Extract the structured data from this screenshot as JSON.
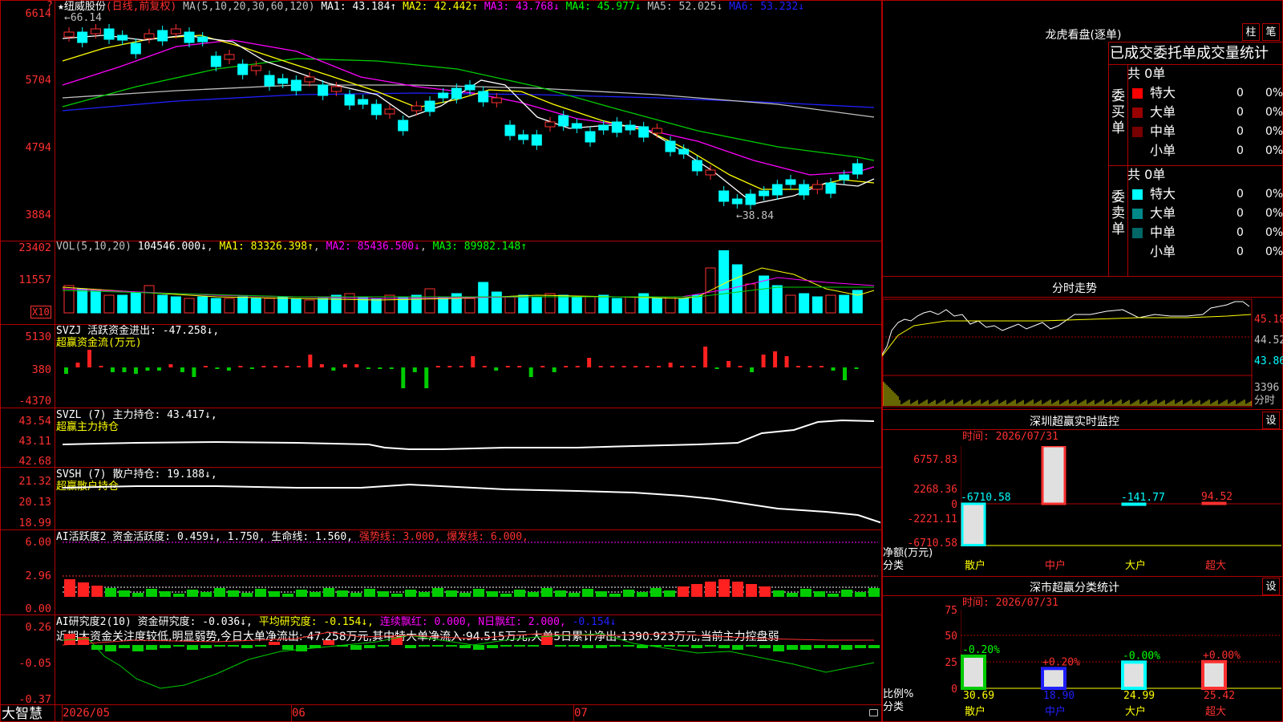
{
  "header": {
    "star": "★",
    "stock_name": "纽威股份",
    "mode": "(日线,前复权)",
    "ma_params": "MA(5,10,20,30,60,120)",
    "ma1": "MA1: 43.184↑",
    "ma2": "MA2: 42.442↑",
    "ma3": "MA3: 43.768↓",
    "ma4": "MA4: 45.977↓",
    "ma5": "MA5: 52.025↓",
    "ma6": "MA6: 53.232↓",
    "q_mark": "?"
  },
  "price_axis": [
    "6614",
    "5704",
    "4794",
    "3884"
  ],
  "price_annotations": {
    "high": "66.14",
    "low": "38.84"
  },
  "vol": {
    "params": "VOL(5,10,20)",
    "value": "104546.000↓",
    "ma1": "MA1: 83326.398↑",
    "ma2": "MA2: 85436.500↓",
    "ma3": "MA3: 89982.148↑",
    "axis": [
      "23402",
      "11557"
    ],
    "unit": "X10"
  },
  "svzj": {
    "label": "SVZJ  活跃资金进出: -47.258↓,",
    "sub": "超赢资金流(万元)",
    "axis": [
      "5130",
      "380",
      "-4370"
    ]
  },
  "svzl": {
    "label": "SVZL (7) 主力持仓: 43.417↓,",
    "sub": "超赢主力持仓",
    "axis": [
      "43.54",
      "43.11",
      "42.68"
    ]
  },
  "svsh": {
    "label": "SVSH (7) 散户持仓: 19.188↓,",
    "sub": "超赢散户持仓",
    "axis": [
      "21.32",
      "20.13",
      "18.99"
    ]
  },
  "ai1": {
    "label": "AI活跃度2 资金活跃度: 0.459↓, 1.750, 生命线: 1.560,",
    "strong": "强势线: 3.000,",
    "burst": "爆发线: 6.000,",
    "axis": [
      "6.00",
      "2.96",
      "0.00"
    ]
  },
  "ai2": {
    "label": "AI研究度2(10) 资金研究度: -0.036↓,",
    "avg": "平均研究度: -0.154↓,",
    "cont": "连续飘红: 0.000,",
    "nday": "N日飘红: 2.000,",
    "last": "-0.154↓",
    "desc": "近期大资金关注度较低,明显弱势,今日大单净流出:-47.258万元,其中特大单净流入:94.515万元,大单5日累计净出-1390.923万元,当前主力控盘弱",
    "axis": [
      "0.26",
      "-0.05",
      "-0.37"
    ]
  },
  "bottom_bar": {
    "brand": "大智慧",
    "dates": [
      "2026/05",
      "06",
      "07"
    ]
  },
  "right_panel": {
    "lhb_title": "龙虎看盘(逐单)",
    "btn_zhu": "柱",
    "btn_bi": "笔",
    "stats_title": "已成交委托单成交量统计",
    "buy_side": "委买单",
    "sell_side": "委卖单",
    "buy_total": "共 0单",
    "sell_total": "共 0单",
    "rows": [
      {
        "name": "特大",
        "count": "0",
        "pct": "0%"
      },
      {
        "name": "大单",
        "count": "0",
        "pct": "0%"
      },
      {
        "name": "中单",
        "count": "0",
        "pct": "0%"
      },
      {
        "name": "小单",
        "count": "0",
        "pct": "0%"
      }
    ],
    "colors": {
      "buy": [
        "#ff0000",
        "#990000",
        "#770000"
      ],
      "sell": [
        "#00ffff",
        "#008888",
        "#006666"
      ]
    },
    "intraday_title": "分时走势",
    "intraday_axis": [
      "45.18",
      "44.52",
      "43.86",
      "3396",
      "分时"
    ],
    "sz_monitor_title": "深圳超赢实时监控",
    "settings_btn": "设",
    "monitor_time": "时间: 2026/07/31",
    "monitor_axis": [
      "6757.83",
      "2268.36",
      "0",
      "-2221.11",
      "-6710.58"
    ],
    "monitor_values": [
      "-6710.58",
      "6757.83",
      "-141.77",
      "94.52"
    ],
    "monitor_ylabel": "净额(万元)",
    "monitor_xlabel": "分类",
    "categories": [
      "散户",
      "中户",
      "大户",
      "超大"
    ],
    "class_title": "深市超赢分类统计",
    "class_time": "时间: 2026/07/31",
    "class_axis": [
      "75",
      "50",
      "25",
      "0"
    ],
    "class_changes": [
      "-0.20%",
      "+0.20%",
      "-0.00%",
      "+0.00%"
    ],
    "class_values": [
      "30.69",
      "18.90",
      "24.99",
      "25.42"
    ],
    "class_ylabel": "比例%",
    "class_xlabel": "分类"
  }
}
